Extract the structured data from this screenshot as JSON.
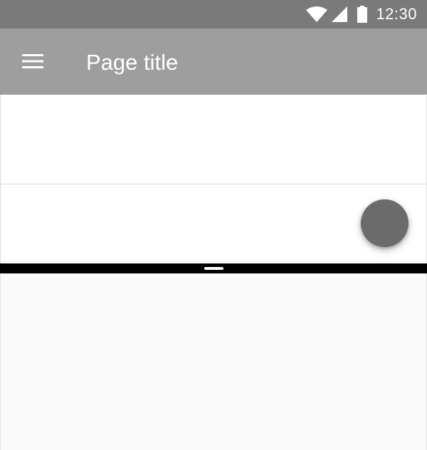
{
  "status_bar": {
    "time": "12:30",
    "icons": [
      "wifi-icon",
      "signal-icon",
      "battery-icon"
    ]
  },
  "app_bar": {
    "title": "Page title",
    "menu_icon": "menu-icon"
  },
  "colors": {
    "status_bar": "#7a7a7a",
    "app_bar": "#9e9e9e",
    "fab": "#6b6b6b",
    "divider": "#000000",
    "bottom_pane": "#fafafa"
  }
}
